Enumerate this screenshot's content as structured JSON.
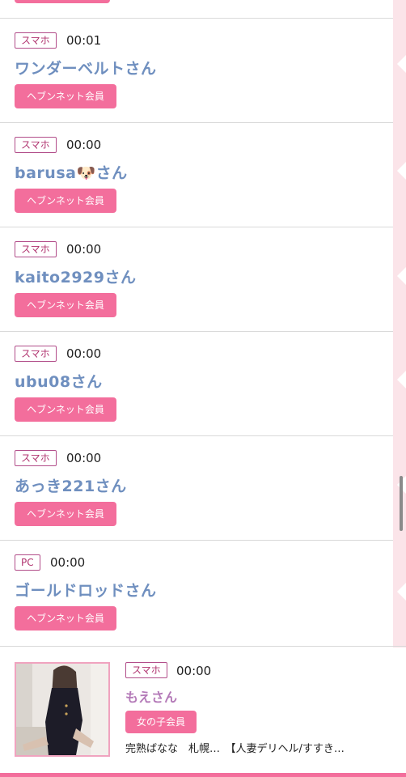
{
  "visitors": [
    {
      "device": "スマホ",
      "time": "00:01",
      "name": "ワンダーベルトさん",
      "badge": "ヘブンネット会員"
    },
    {
      "device": "スマホ",
      "time": "00:00",
      "name": "barusa🐶さん",
      "badge": "ヘブンネット会員"
    },
    {
      "device": "スマホ",
      "time": "00:00",
      "name": "kaito2929さん",
      "badge": "ヘブンネット会員"
    },
    {
      "device": "スマホ",
      "time": "00:00",
      "name": "ubu08さん",
      "badge": "ヘブンネット会員"
    },
    {
      "device": "スマホ",
      "time": "00:00",
      "name": "あっき221さん",
      "badge": "ヘブンネット会員"
    },
    {
      "device": "PC",
      "time": "00:00",
      "name": "ゴールドロッドさん",
      "badge": "ヘブンネット会員"
    }
  ],
  "featured": {
    "device": "スマホ",
    "time": "00:00",
    "name": "もえさん",
    "badge": "女の子会員",
    "shop": "完熟ばなな　札幌…　【人妻デリヘル/すすき…"
  },
  "colors": {
    "accent": "#f36e9c",
    "name_blue": "#6f8fbf",
    "name_pink": "#b47ab8",
    "tag_border": "#b24e8a"
  }
}
